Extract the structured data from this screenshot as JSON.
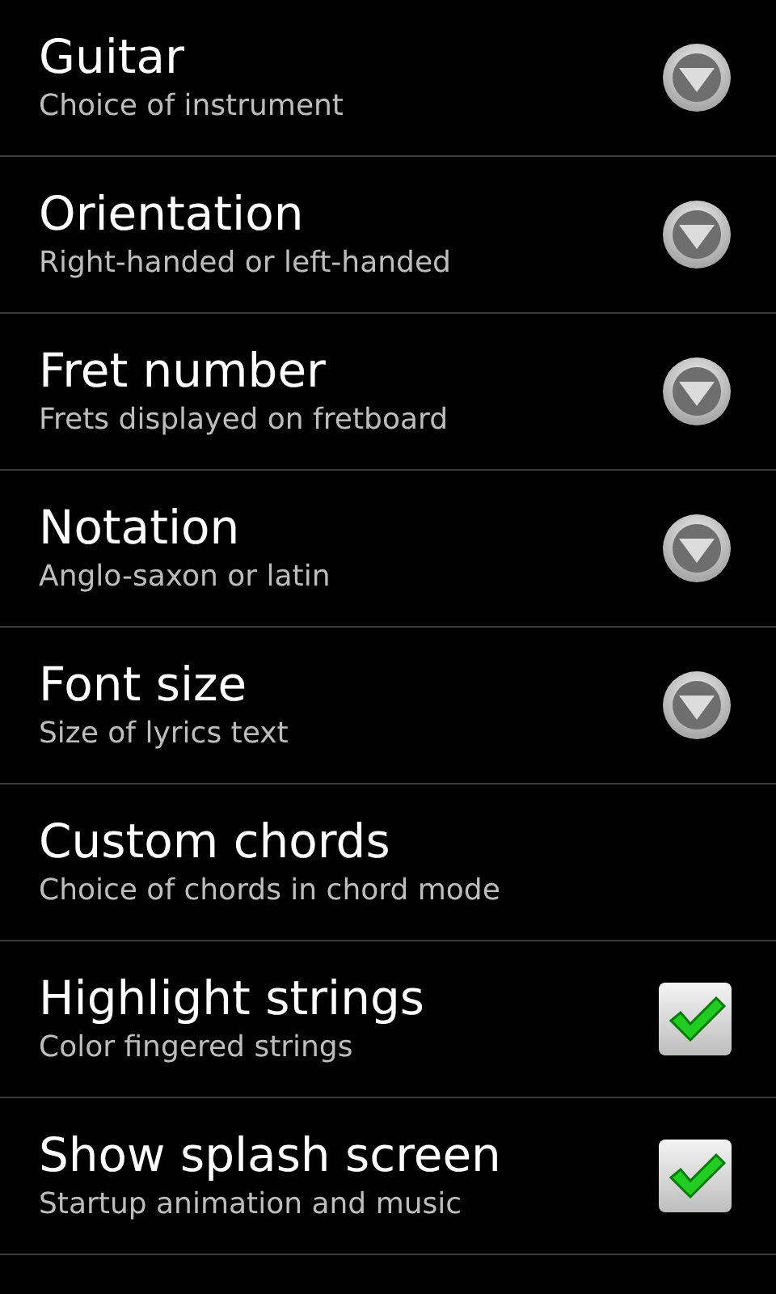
{
  "settings": [
    {
      "kind": "dropdown",
      "title": "Guitar",
      "summary": "Choice of instrument"
    },
    {
      "kind": "dropdown",
      "title": "Orientation",
      "summary": "Right-handed or left-handed"
    },
    {
      "kind": "dropdown",
      "title": "Fret number",
      "summary": "Frets displayed on fretboard"
    },
    {
      "kind": "dropdown",
      "title": "Notation",
      "summary": "Anglo-saxon or latin"
    },
    {
      "kind": "dropdown",
      "title": "Font size",
      "summary": "Size of lyrics text"
    },
    {
      "kind": "plain",
      "title": "Custom chords",
      "summary": "Choice of chords in chord mode"
    },
    {
      "kind": "checkbox",
      "title": "Highlight strings",
      "summary": "Color fingered strings",
      "checked": true
    },
    {
      "kind": "checkbox",
      "title": "Show splash screen",
      "summary": "Startup animation and music",
      "checked": true
    }
  ]
}
